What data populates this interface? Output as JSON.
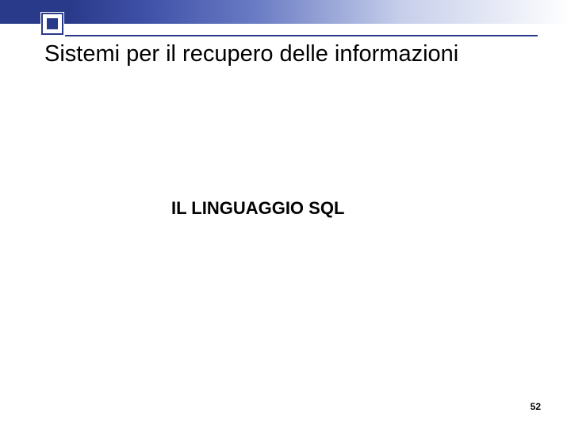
{
  "slide": {
    "title": "Sistemi per il recupero delle informazioni",
    "subtitle": "IL LINGUAGGIO SQL",
    "page_number": "52"
  }
}
